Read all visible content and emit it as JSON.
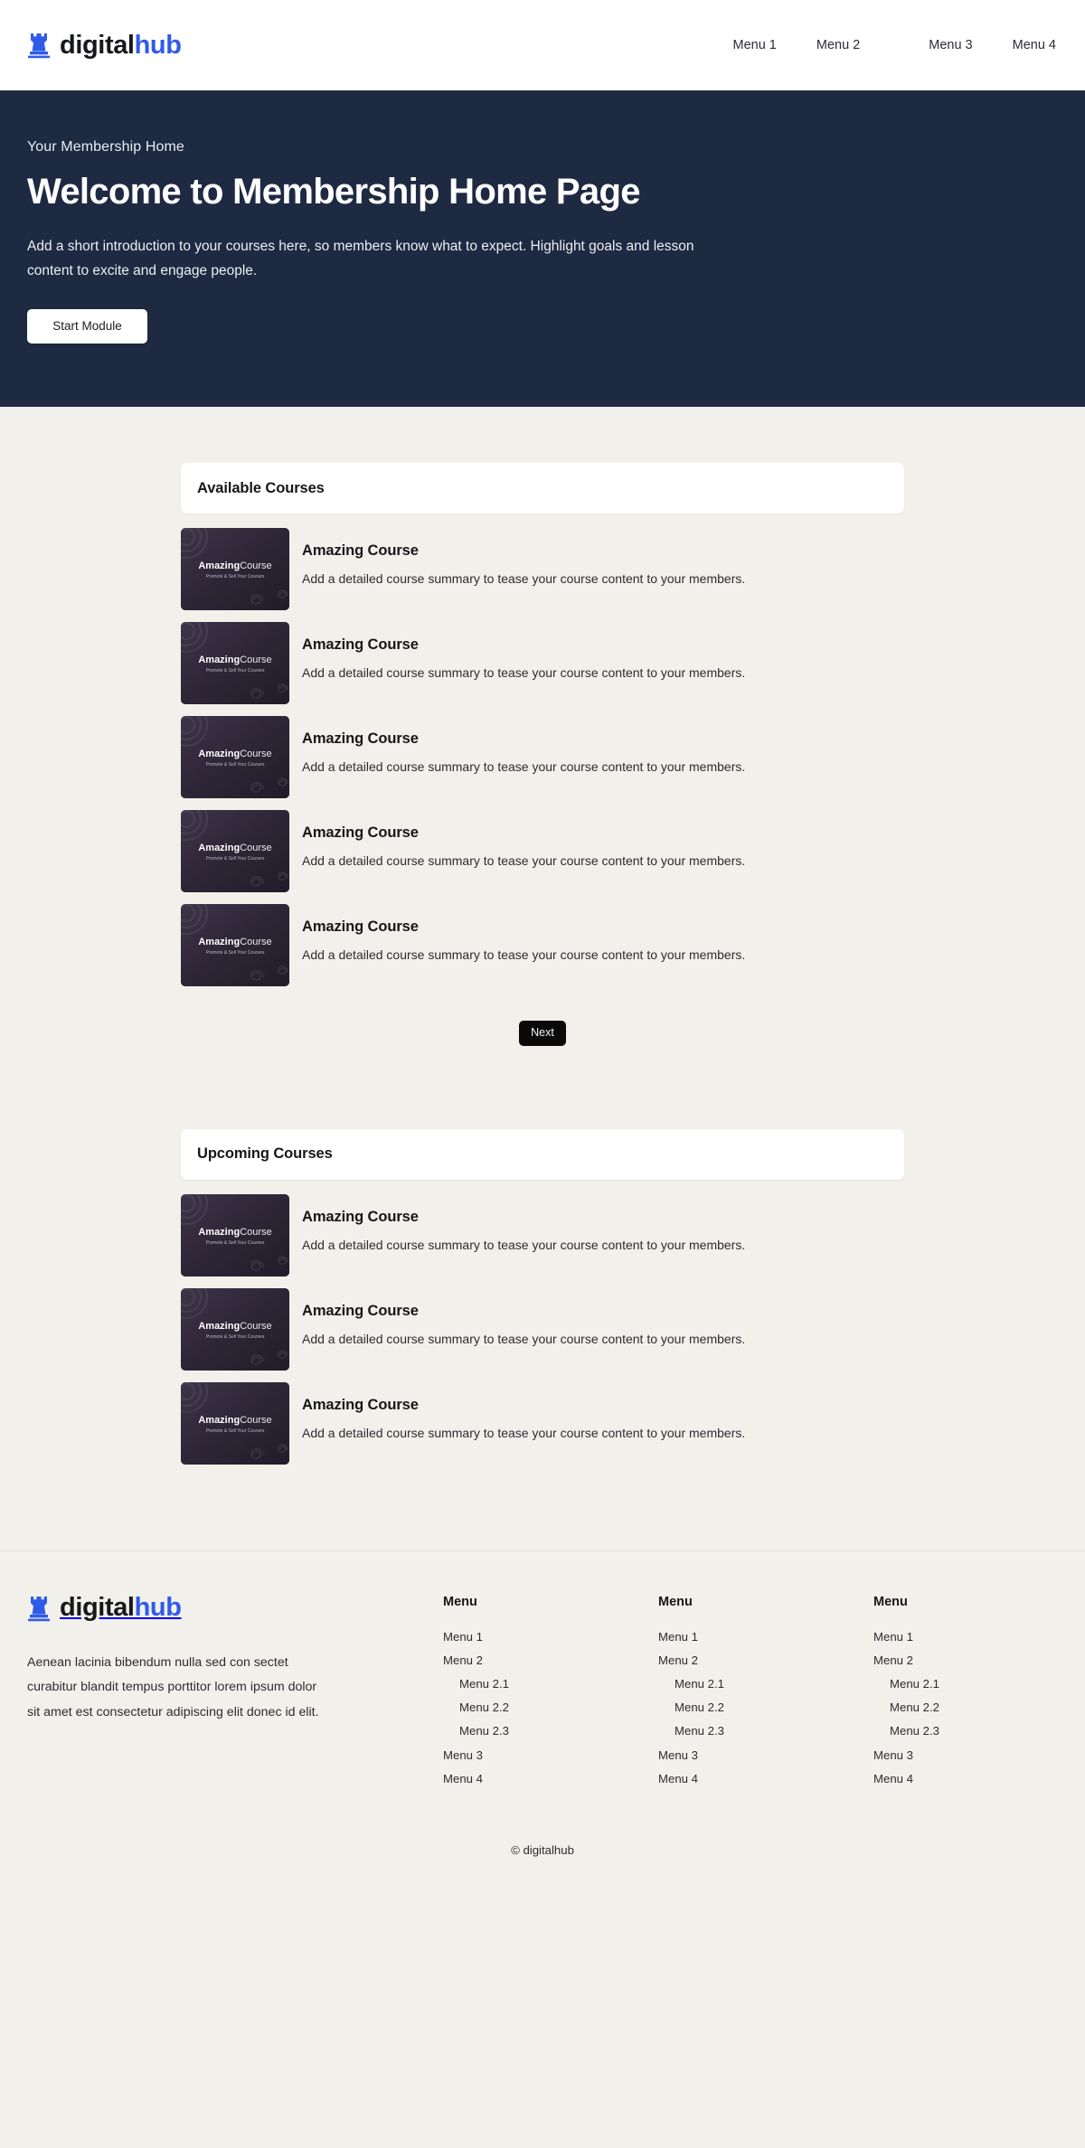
{
  "brand": {
    "name_dark": "digital",
    "name_accent": "hub",
    "logo_icon": "chess-rook-icon",
    "accent_color": "#2f5bea",
    "dark_color": "#17181c"
  },
  "header": {
    "nav": [
      {
        "label": "Menu 1"
      },
      {
        "label": "Menu 2"
      },
      {
        "label": "Menu 3"
      },
      {
        "label": "Menu 4"
      }
    ]
  },
  "hero": {
    "eyebrow": "Your Membership Home",
    "title": "Welcome to Membership Home Page",
    "description": "Add a short introduction to your courses here, so members know what to expect. Highlight goals and lesson content to excite and engage people.",
    "cta_label": "Start Module",
    "background_color": "#1e2a42"
  },
  "thumbnail": {
    "title_bold": "Amazing",
    "title_light": "Course",
    "subtitle": "Promote & Sell Your Courses"
  },
  "sections": [
    {
      "title": "Available Courses",
      "courses": [
        {
          "name": "Amazing Course",
          "description": "Add a detailed course summary to tease your course content to your members."
        },
        {
          "name": "Amazing Course",
          "description": "Add a detailed course summary to tease your course content to your members."
        },
        {
          "name": "Amazing Course",
          "description": "Add a detailed course summary to tease your course content to your members."
        },
        {
          "name": "Amazing Course",
          "description": "Add a detailed course summary to tease your course content to your members."
        },
        {
          "name": "Amazing Course",
          "description": "Add a detailed course summary to tease your course content to your members."
        }
      ],
      "pager_label": "Next"
    },
    {
      "title": "Upcoming Courses",
      "courses": [
        {
          "name": "Amazing Course",
          "description": "Add a detailed course summary to tease your course content to your members."
        },
        {
          "name": "Amazing Course",
          "description": "Add a detailed course summary to tease your course content to your members."
        },
        {
          "name": "Amazing Course",
          "description": "Add a detailed course summary to tease your course content to your members."
        }
      ]
    }
  ],
  "footer": {
    "about": "Aenean lacinia bibendum nulla sed con sectet curabitur blandit tempus porttitor lorem ipsum dolor sit amet est consectetur adipiscing elit donec id elit.",
    "columns": [
      {
        "title": "Menu",
        "links": [
          {
            "label": "Menu 1",
            "sub": false
          },
          {
            "label": "Menu 2",
            "sub": false
          },
          {
            "label": "Menu 2.1",
            "sub": true
          },
          {
            "label": "Menu 2.2",
            "sub": true
          },
          {
            "label": "Menu 2.3",
            "sub": true
          },
          {
            "label": "Menu 3",
            "sub": false
          },
          {
            "label": "Menu 4",
            "sub": false
          }
        ]
      },
      {
        "title": "Menu",
        "links": [
          {
            "label": "Menu 1",
            "sub": false
          },
          {
            "label": "Menu 2",
            "sub": false
          },
          {
            "label": "Menu 2.1",
            "sub": true
          },
          {
            "label": "Menu 2.2",
            "sub": true
          },
          {
            "label": "Menu 2.3",
            "sub": true
          },
          {
            "label": "Menu 3",
            "sub": false
          },
          {
            "label": "Menu 4",
            "sub": false
          }
        ]
      },
      {
        "title": "Menu",
        "links": [
          {
            "label": "Menu 1",
            "sub": false
          },
          {
            "label": "Menu 2",
            "sub": false
          },
          {
            "label": "Menu 2.1",
            "sub": true
          },
          {
            "label": "Menu 2.2",
            "sub": true
          },
          {
            "label": "Menu 2.3",
            "sub": true
          },
          {
            "label": "Menu 3",
            "sub": false
          },
          {
            "label": "Menu 4",
            "sub": false
          }
        ]
      }
    ],
    "copyright": "© digitalhub"
  }
}
